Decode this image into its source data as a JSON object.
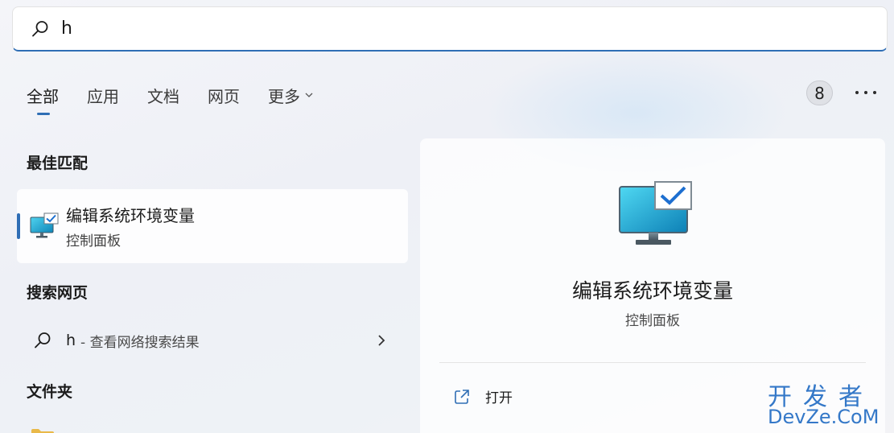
{
  "search": {
    "value": "h"
  },
  "tabs": [
    {
      "label": "全部",
      "active": true
    },
    {
      "label": "应用"
    },
    {
      "label": "文档"
    },
    {
      "label": "网页"
    },
    {
      "label": "更多"
    }
  ],
  "header": {
    "badge_count": "8"
  },
  "best_match": {
    "section_title": "最佳匹配",
    "item": {
      "title": "编辑系统环境变量",
      "subtitle": "控制面板"
    }
  },
  "web_search": {
    "section_title": "搜索网页",
    "term": "h",
    "hint": "- 查看网络搜索结果"
  },
  "folders": {
    "section_title": "文件夹"
  },
  "detail": {
    "title": "编辑系统环境变量",
    "subtitle": "控制面板",
    "actions": [
      {
        "label": "打开"
      }
    ]
  },
  "watermark": {
    "top": "开发者",
    "bottom": "DevZe.CoM"
  },
  "colors": {
    "accent": "#2f6eb5",
    "monitor": "#1aa3c7",
    "watermark": "#3478c8"
  }
}
